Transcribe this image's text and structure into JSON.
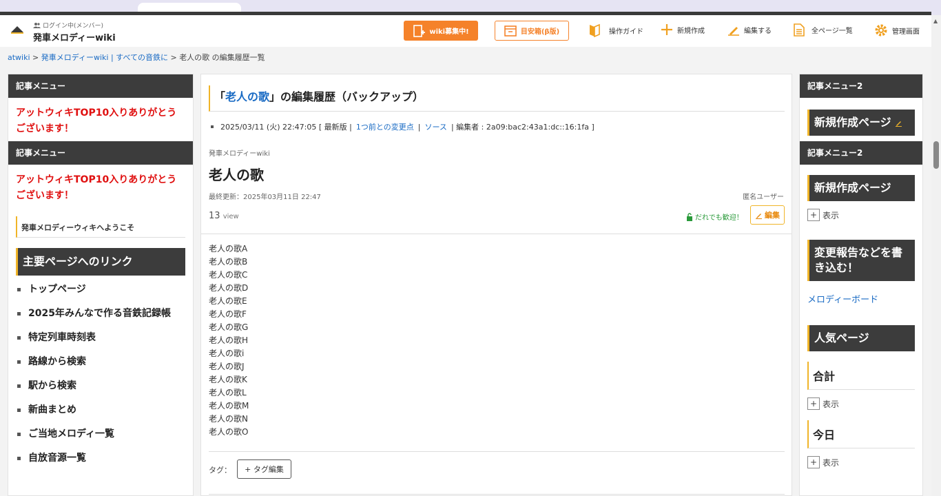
{
  "header": {
    "login_status": "ログイン中(メンバー)",
    "site_title": "発車メロディーwiki",
    "wiki_recruit_label": "wiki募集中!",
    "meyasu_label": "目安箱(β版)",
    "nav": [
      {
        "label": "操作ガイド",
        "icon": "book-icon"
      },
      {
        "label": "新規作成",
        "icon": "plus-icon"
      },
      {
        "label": "編集する",
        "icon": "pencil-icon"
      },
      {
        "label": "全ページ一覧",
        "icon": "document-icon"
      },
      {
        "label": "管理画面",
        "icon": "gear-icon"
      }
    ]
  },
  "breadcrumb": {
    "root": "atwiki",
    "sep": ">",
    "parent": "発車メロディーwiki | すべての音鉄に",
    "current": "老人の歌 の編集履歴一覧"
  },
  "left": {
    "menu_header_1": "記事メニュー",
    "notice_1": "アットウィキTOP10入りありがとうございます！",
    "menu_header_2": "記事メニュー",
    "notice_2": "アットウィキTOP10入りありがとうございます！",
    "welcome": "発車メロディーウィキへようこそ",
    "links_title": "主要ページへのリンク",
    "links": [
      "トップページ",
      "2025年みんなで作る音鉄記録帳",
      "特定列車時刻表",
      "路線から検索",
      "駅から検索",
      "新曲まとめ",
      "ご当地メロディ一覧",
      "自放音源一覧"
    ]
  },
  "main": {
    "heading_open": "「",
    "heading_link": "老人の歌",
    "heading_close": "」の編集履歴（バックアップ）",
    "meta_date": "2025/03/11 (火) 22:47:05 [ 最新版 |",
    "meta_diff": "1つ前との変更点",
    "meta_sep": "|",
    "meta_source": "ソース",
    "meta_editor": "| 編集者 : 2a09:bac2:43a1:dc::16:1fa ]",
    "site_small": "発車メロディーwiki",
    "page_title": "老人の歌",
    "updated": "最終更新：2025年03月11日 22:47",
    "author": "匿名ユーザー",
    "views_count": "13",
    "views_unit": "view",
    "welcome_lock": "だれでも歓迎！",
    "edit_label": "編集",
    "content": [
      "老人の歌A",
      "老人の歌B",
      "老人の歌C",
      "老人の歌D",
      "老人の歌E",
      "老人の歌F",
      "老人の歌G",
      "老人の歌H",
      "老人の歌i",
      "老人の歌J",
      "老人の歌K",
      "老人の歌L",
      "老人の歌M",
      "老人の歌N",
      "老人の歌O"
    ],
    "tag_label": "タグ：",
    "tag_edit_label": "+ タグ編集"
  },
  "right": {
    "menu2_header_1": "記事メニュー2",
    "new_page_1": "新規作成ページ",
    "menu2_header_2": "記事メニュー2",
    "new_page_2": "新規作成ページ",
    "show_1": "表示",
    "report_block": "変更報告などを書き込む！",
    "melody_board": "メロディーボード",
    "popular": "人気ページ",
    "total": "合計",
    "show_2": "表示",
    "today": "今日",
    "show_3": "表示",
    "plus_sign": "+"
  },
  "colors": {
    "accent_orange": "#f5822a",
    "accent_yellow": "#f0b428",
    "dark_header": "#3c3c3c",
    "link_blue": "#1a6bc4",
    "notice_red": "#e01010"
  }
}
